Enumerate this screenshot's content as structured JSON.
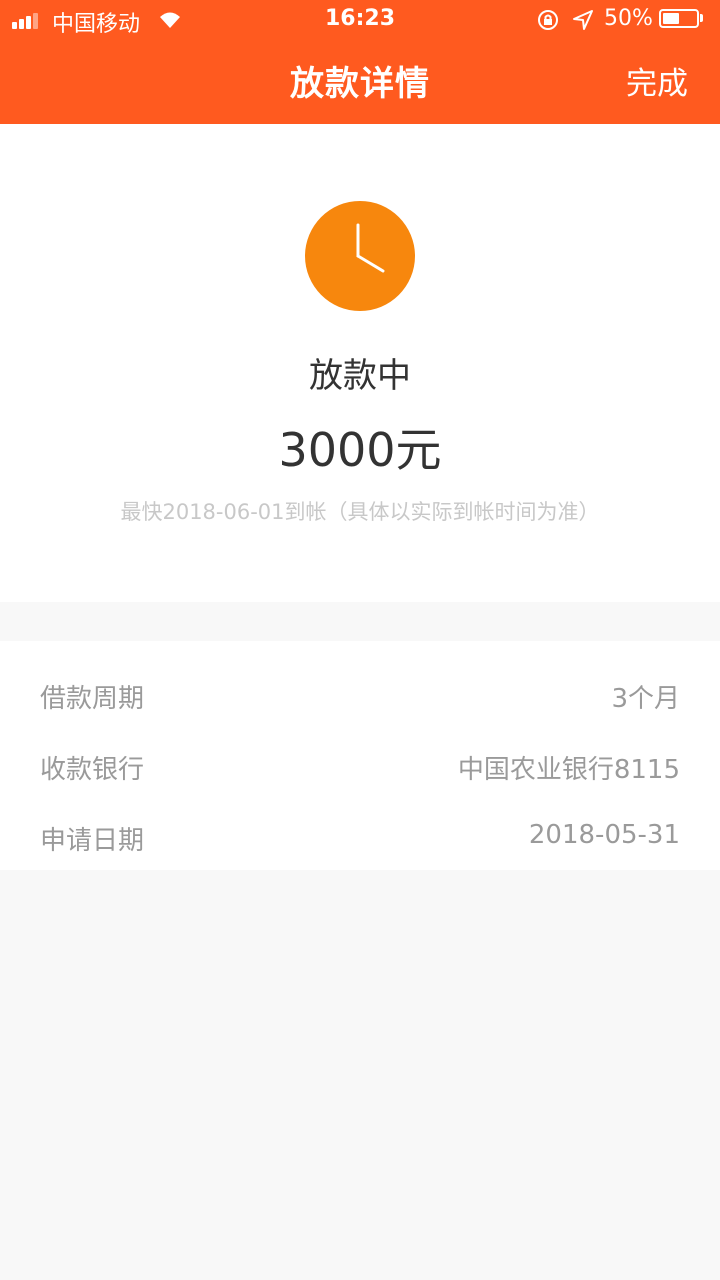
{
  "status_bar": {
    "carrier": "中国移动",
    "time": "16:23",
    "battery_percent": "50%",
    "battery_level": 0.5,
    "icons": [
      "signal-icon",
      "wifi-icon",
      "rotation-lock-icon",
      "location-icon",
      "battery-icon"
    ]
  },
  "nav": {
    "title": "放款详情",
    "done_label": "完成"
  },
  "status": {
    "icon": "clock-icon",
    "label": "放款中",
    "amount": "3000元",
    "note": "最快2018-06-01到帐（具体以实际到帐时间为准）"
  },
  "details": [
    {
      "label": "借款周期",
      "value": "3个月"
    },
    {
      "label": "收款银行",
      "value": "中国农业银行8115"
    },
    {
      "label": "申请日期",
      "value": "2018-05-31"
    }
  ],
  "colors": {
    "header": "#ff5a1f",
    "accent": "#f7870d",
    "muted_text": "#9a9a9a"
  }
}
